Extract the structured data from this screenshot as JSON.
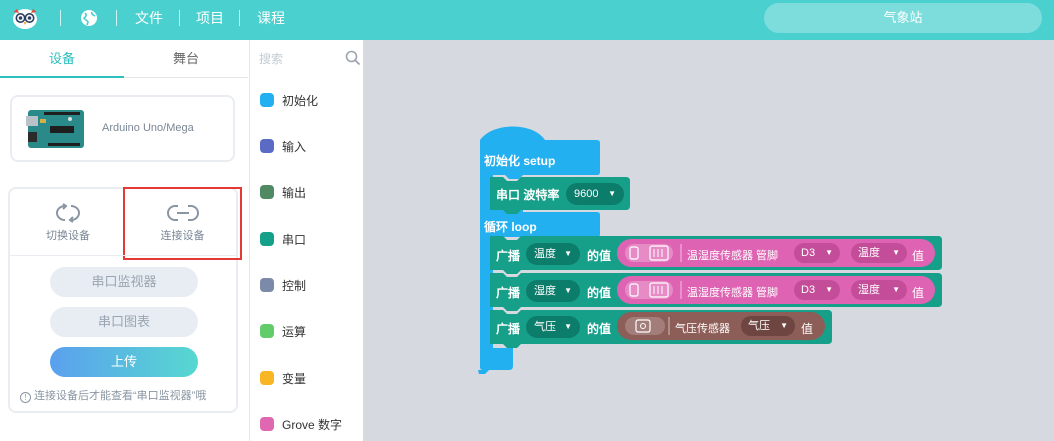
{
  "menu": {
    "file": "文件",
    "project": "项目",
    "course": "课程"
  },
  "project_name": "气象站",
  "left_tabs": {
    "devices": "设备",
    "stage": "舞台"
  },
  "device": {
    "name": "Arduino Uno/Mega"
  },
  "connection": {
    "switch_label": "切换设备",
    "connect_label": "连接设备",
    "serial_monitor": "串口监视器",
    "serial_plot": "串口图表",
    "upload": "上传",
    "hint": "连接设备后才能查看“串口监视器”哦"
  },
  "search": {
    "placeholder": "搜索"
  },
  "categories": [
    {
      "label": "初始化",
      "color": "#22b0f0"
    },
    {
      "label": "输入",
      "color": "#5b6bc5"
    },
    {
      "label": "输出",
      "color": "#4f8a63"
    },
    {
      "label": "串口",
      "color": "#16a08a"
    },
    {
      "label": "控制",
      "color": "#7a8aa8"
    },
    {
      "label": "运算",
      "color": "#63cc6a"
    },
    {
      "label": "变量",
      "color": "#f8b625"
    },
    {
      "label": "Grove 数字",
      "color": "#e068b0"
    }
  ],
  "blocks": {
    "setup": "初始化 setup",
    "serial_prefix": "串口 波特率",
    "baud": "9600",
    "loop": "循环 loop",
    "broadcast": "广播",
    "value_of": "的值",
    "row1": {
      "var": "温度",
      "sensor": "温湿度传感器 管脚",
      "pin": "D3",
      "field": "温度",
      "suffix": "值"
    },
    "row2": {
      "var": "湿度",
      "sensor": "温湿度传感器 管脚",
      "pin": "D3",
      "field": "湿度",
      "suffix": "值"
    },
    "row3": {
      "var": "气压",
      "sensor": "气压传感器",
      "field": "气压",
      "suffix": "值"
    }
  },
  "colors": {
    "topbar": "#4ad0cf",
    "setup_block": "#22b0f0",
    "serial_block": "#16a08a",
    "serial_dark": "#0d7d6b",
    "sensor_pink": "#de64b3",
    "sensor_pink_dark": "#c44d99",
    "sensor_brown": "#8d5d58",
    "sensor_brown_dark": "#6f4541"
  }
}
